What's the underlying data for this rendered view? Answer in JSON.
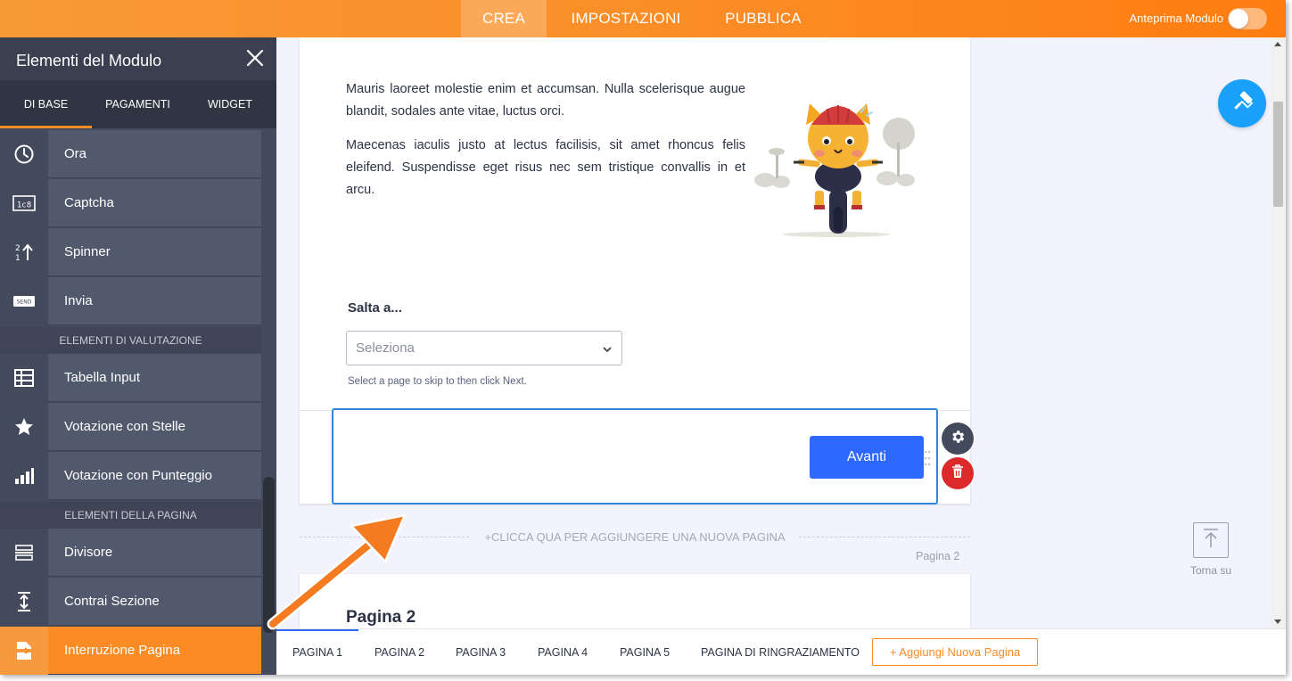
{
  "topbar": {
    "tabs": [
      "CREA",
      "IMPOSTAZIONI",
      "PUBBLICA"
    ],
    "preview_label": "Anteprima Modulo"
  },
  "sidebar": {
    "title": "Elementi del Modulo",
    "tabs": [
      "DI BASE",
      "PAGAMENTI",
      "WIDGET"
    ],
    "items": [
      {
        "label": "Ora",
        "icon": "clock-icon"
      },
      {
        "label": "Captcha",
        "icon": "captcha-icon"
      },
      {
        "label": "Spinner",
        "icon": "spinner-icon"
      },
      {
        "label": "Invia",
        "icon": "send-icon"
      },
      {
        "label": "Tabella Input",
        "icon": "table-icon"
      },
      {
        "label": "Votazione con Stelle",
        "icon": "star-icon"
      },
      {
        "label": "Votazione con Punteggio",
        "icon": "bar-chart-icon"
      },
      {
        "label": "Divisore",
        "icon": "divider-icon"
      },
      {
        "label": "Contrai Sezione",
        "icon": "collapse-icon"
      },
      {
        "label": "Interruzione Pagina",
        "icon": "page-break-icon"
      }
    ],
    "sections": [
      "ELEMENTI DI VALUTAZIONE",
      "ELEMENTI DELLA PAGINA"
    ],
    "send_icon_text": "SEND",
    "captcha_icon_text": "1c8"
  },
  "form": {
    "paragraph1": "Mauris laoreet molestie enim et accumsan. Nulla scelerisque augue blandit, sodales ante vitae, luctus orci.",
    "paragraph2": "Maecenas iaculis justo at lectus facilisis, sit amet rhoncus felis eleifend. Suspendisse eget risus nec sem tristique convallis in et arcu.",
    "skip_label": "Salta a...",
    "skip_select_value": "Seleziona",
    "skip_help": "Select a page to skip to then click Next.",
    "next_button": "Avanti",
    "add_page_text": "+CLICCA QUA PER AGGIUNGERE UNA NUOVA PAGINA",
    "page_tag": "Pagina 2",
    "page2_title": "Pagina 2",
    "to_top_label": "Torna su"
  },
  "pagebar": {
    "tabs": [
      "PAGINA 1",
      "PAGINA 2",
      "PAGINA 3",
      "PAGINA 4",
      "PAGINA 5",
      "PAGINA DI RINGRAZIAMENTO"
    ],
    "active_index": 0,
    "add_button": "+ Aggiungi Nuova Pagina"
  },
  "colors": {
    "accent_orange": "#fb8b24",
    "sidebar_bg": "#434a5c",
    "primary_blue": "#2e69ff",
    "selection_blue": "#2e86de",
    "danger_red": "#dc2929",
    "paint_button_blue": "#18a0fb"
  }
}
